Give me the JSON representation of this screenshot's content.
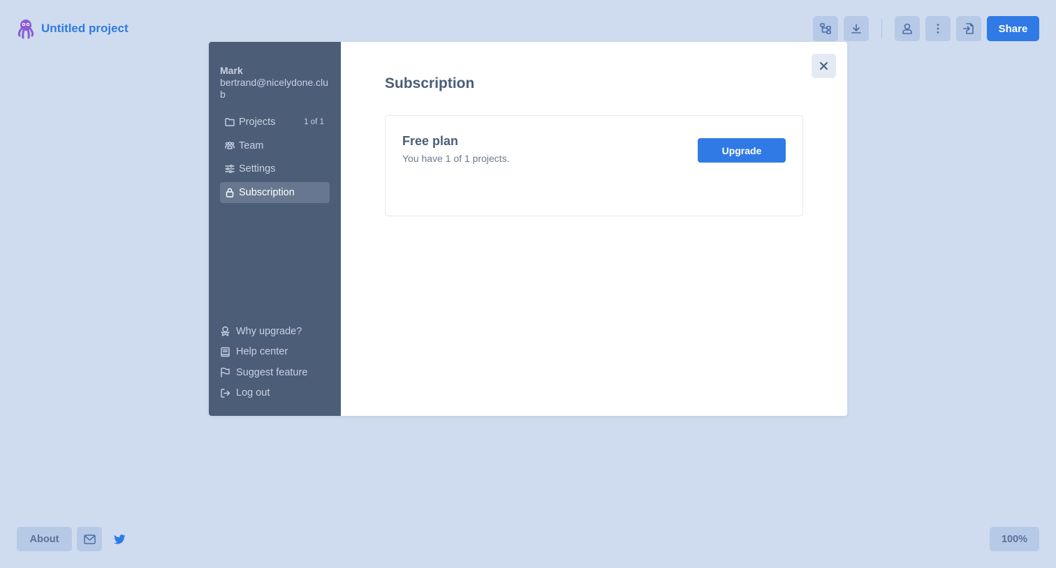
{
  "header": {
    "project_title": "Untitled project",
    "share_label": "Share",
    "toolbar_icons": [
      "diagram-icon",
      "download-icon",
      "user-icon",
      "more-icon",
      "import-icon"
    ]
  },
  "account": {
    "name": "Mark",
    "email": "bertrand@nicelydone.club"
  },
  "sidebar": {
    "items": [
      {
        "label": "Projects",
        "count": "1 of 1",
        "icon": "folder-icon"
      },
      {
        "label": "Team",
        "icon": "team-icon"
      },
      {
        "label": "Settings",
        "icon": "sliders-icon"
      },
      {
        "label": "Subscription",
        "icon": "lock-icon",
        "active": true
      }
    ],
    "bottom": [
      {
        "label": "Why upgrade?",
        "icon": "award-icon"
      },
      {
        "label": "Help center",
        "icon": "book-icon"
      },
      {
        "label": "Suggest feature",
        "icon": "flag-icon"
      },
      {
        "label": "Log out",
        "icon": "logout-icon"
      }
    ]
  },
  "main": {
    "title": "Subscription",
    "plan": {
      "name": "Free plan",
      "description": "You have 1 of 1 projects.",
      "upgrade_label": "Upgrade"
    }
  },
  "footer": {
    "about_label": "About",
    "zoom": "100%"
  },
  "colors": {
    "background": "#cfdcef",
    "accent": "#2f7ae5",
    "sidebar": "#4c5d78",
    "logo": "#8b5ad6"
  }
}
